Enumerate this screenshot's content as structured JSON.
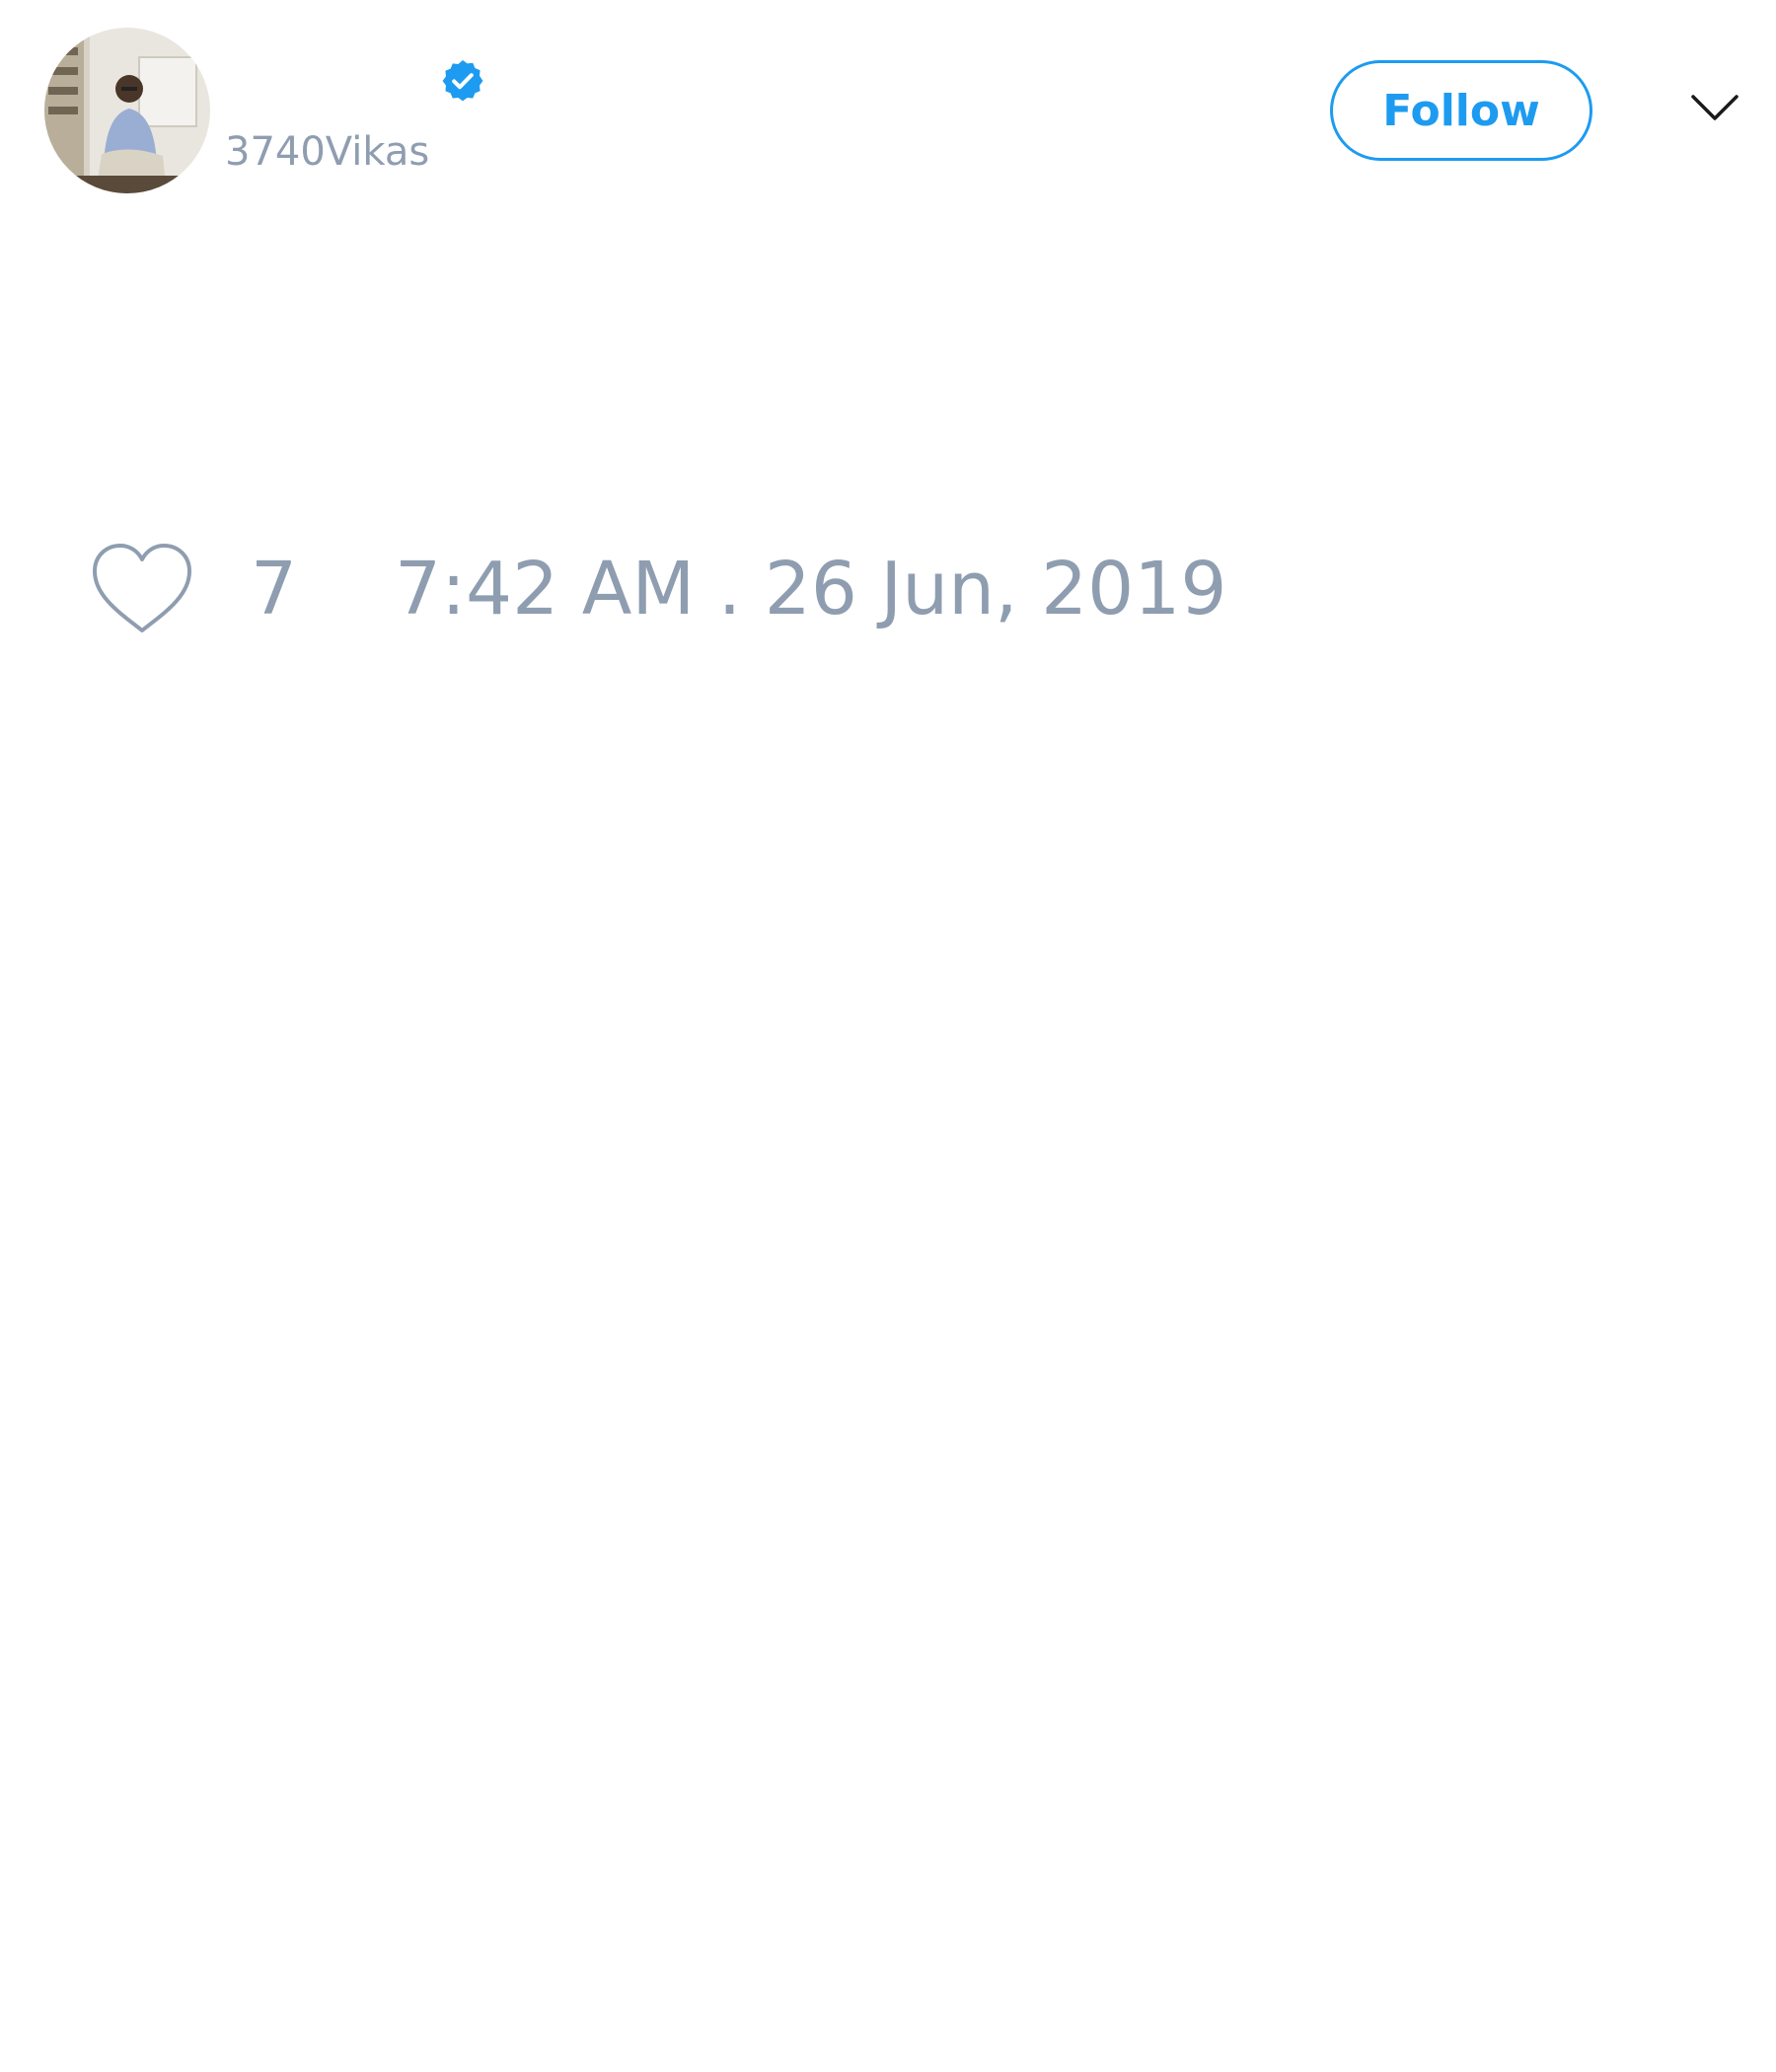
{
  "author": {
    "display_name": "",
    "handle": "3740Vikas",
    "verified": true,
    "avatar_icon": "profile-photo"
  },
  "actions": {
    "follow_label": "Follow",
    "menu_icon": "chevron-down-icon"
  },
  "stats": {
    "like_icon": "heart-outline-icon",
    "like_count": "7",
    "timestamp": "7:42 AM . 26 Jun, 2019"
  },
  "colors": {
    "accent": "#1d9bf0",
    "muted_text": "#8f9db0",
    "background": "#ffffff"
  }
}
